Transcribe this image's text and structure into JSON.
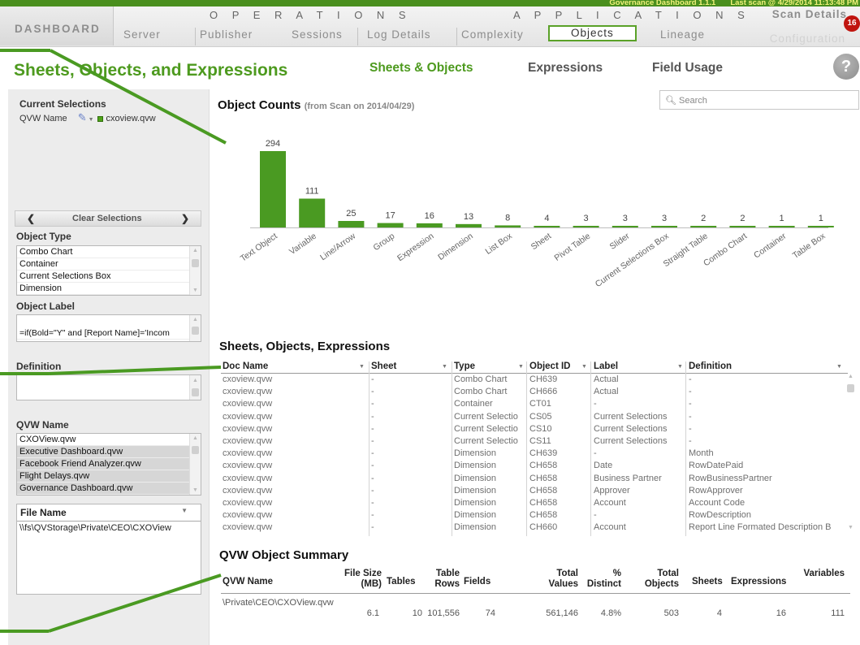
{
  "topbar": {
    "version_text": "Governance Dashboard 1.1.1",
    "scan_text": "Last scan @ 4/29/2014 11:13:48 PM"
  },
  "nav": {
    "dashboard": "DASHBOARD",
    "operations_label": "O P E R A T I O N S",
    "applications_label": "A P P L I C A T I O N S",
    "tabs": [
      "Server",
      "Publisher",
      "Sessions",
      "Log Details",
      "Complexity",
      "Objects",
      "Lineage"
    ],
    "active_tab": "Objects",
    "scan_details": "Scan Details",
    "scan_badge": "16",
    "configuration": "Configuration"
  },
  "page": {
    "title": "Sheets, Objects, and Expressions",
    "subtabs": [
      "Sheets & Objects",
      "Expressions",
      "Field Usage"
    ],
    "active_subtab": "Sheets & Objects",
    "help": "?"
  },
  "left": {
    "current_selections_title": "Current Selections",
    "selection_field": "QVW Name",
    "selection_value": "cxoview.qvw",
    "clear_label": "Clear Selections",
    "object_type_title": "Object Type",
    "object_types": [
      "Combo Chart",
      "Container",
      "Current Selections Box",
      "Dimension"
    ],
    "object_label_title": "Object Label",
    "object_label_value": "=if(Bold=\"Y\" and [Report Name]='Incom",
    "definition_title": "Definition",
    "qvw_name_title": "QVW Name",
    "qvw_names": [
      "CXOView.qvw",
      "Executive Dashboard.qvw",
      "Facebook Friend Analyzer.qvw",
      "Flight Delays.qvw",
      "Governance Dashboard.qvw"
    ],
    "file_name_title": "File Name",
    "file_name_value": "\\\\fs\\QVStorage\\Private\\CEO\\CXOView"
  },
  "search": {
    "placeholder": "Search"
  },
  "object_counts": {
    "title": "Object Counts",
    "subtitle": "(from Scan on 2014/04/29)"
  },
  "chart_data": {
    "type": "bar",
    "title": "Object Counts",
    "subtitle": "(from Scan on 2014/04/29)",
    "categories": [
      "Text Object",
      "Variable",
      "Line/Arrow",
      "Group",
      "Expression",
      "Dimension",
      "List Box",
      "Sheet",
      "Pivot Table",
      "Slider",
      "Current Selections Box",
      "Straight Table",
      "Combo Chart",
      "Container",
      "Table Box"
    ],
    "values": [
      294,
      111,
      25,
      17,
      16,
      13,
      8,
      4,
      3,
      3,
      3,
      2,
      2,
      1,
      1
    ],
    "color": "#4a9a22",
    "ylim": [
      0,
      294
    ]
  },
  "table": {
    "title": "Sheets, Objects, Expressions",
    "columns": [
      "Doc Name",
      "Sheet",
      "Type",
      "Object ID",
      "Label",
      "Definition"
    ],
    "rows": [
      [
        "cxoview.qvw",
        "-",
        "Combo Chart",
        "CH639",
        "Actual",
        "-"
      ],
      [
        "cxoview.qvw",
        "-",
        "Combo Chart",
        "CH666",
        "Actual",
        "-"
      ],
      [
        "cxoview.qvw",
        "-",
        "Container",
        "CT01",
        "-",
        "-"
      ],
      [
        "cxoview.qvw",
        "-",
        "Current Selectio",
        "CS05",
        "Current Selections",
        "-"
      ],
      [
        "cxoview.qvw",
        "-",
        "Current Selectio",
        "CS10",
        "Current Selections",
        "-"
      ],
      [
        "cxoview.qvw",
        "-",
        "Current Selectio",
        "CS11",
        "Current Selections",
        "-"
      ],
      [
        "cxoview.qvw",
        "-",
        "Dimension",
        "CH639",
        "-",
        "Month"
      ],
      [
        "cxoview.qvw",
        "-",
        "Dimension",
        "CH658",
        "Date",
        "RowDatePaid"
      ],
      [
        "cxoview.qvw",
        "-",
        "Dimension",
        "CH658",
        "Business Partner",
        "RowBusinessPartner"
      ],
      [
        "cxoview.qvw",
        "-",
        "Dimension",
        "CH658",
        "Approver",
        "RowApprover"
      ],
      [
        "cxoview.qvw",
        "-",
        "Dimension",
        "CH658",
        "Account",
        "Account Code"
      ],
      [
        "cxoview.qvw",
        "-",
        "Dimension",
        "CH658",
        "-",
        "RowDescription"
      ],
      [
        "cxoview.qvw",
        "-",
        "Dimension",
        "CH660",
        "Account",
        "Report Line Formated Description B"
      ]
    ]
  },
  "summary": {
    "title": "QVW Object Summary",
    "columns": [
      "QVW Name",
      "File Size (MB)",
      "Tables",
      "Table Rows",
      "Fields",
      "Total Values",
      "% Distinct",
      "Total Objects",
      "Sheets",
      "Expressions",
      "Variables"
    ],
    "row": [
      "\\Private\\CEO\\CXOView.qvw",
      "6.1",
      "10",
      "101,556",
      "74",
      "561,146",
      "4.8%",
      "503",
      "4",
      "16",
      "111"
    ]
  }
}
